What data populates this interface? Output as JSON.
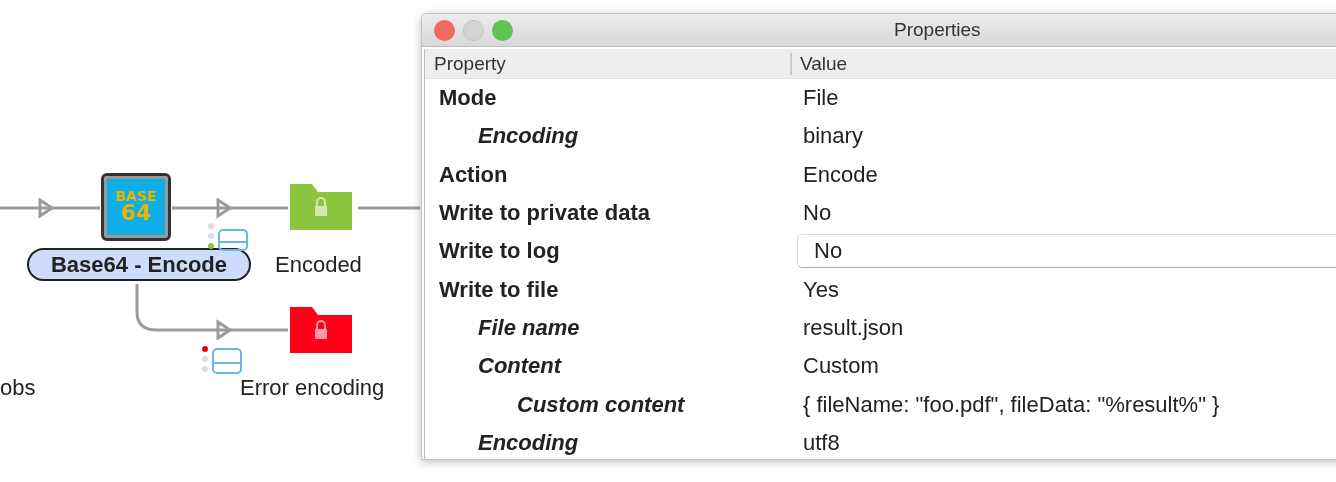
{
  "canvas": {
    "node": {
      "label": "Base64 - Encode",
      "icon_text": [
        "BASE",
        "64"
      ]
    },
    "folders": [
      {
        "label": "Encoded",
        "color": "#8cc63f"
      },
      {
        "label": "Error encoding",
        "color": "#ff0019"
      }
    ],
    "cut_label": "obs"
  },
  "window": {
    "title": "Properties"
  },
  "table": {
    "columns": [
      "Property",
      "Value"
    ],
    "rows": [
      {
        "name": "Mode",
        "value": "File",
        "editing": false,
        "children": [
          {
            "name": "Encoding",
            "value": "binary",
            "editing": false
          }
        ]
      },
      {
        "name": "Action",
        "value": "Encode",
        "editing": false
      },
      {
        "name": "Write to private data",
        "value": "No",
        "editing": false
      },
      {
        "name": "Write to log",
        "value": "No",
        "editing": true
      },
      {
        "name": "Write to file",
        "value": "Yes",
        "editing": false,
        "children": [
          {
            "name": "File name",
            "value": "result.json",
            "editing": false
          },
          {
            "name": "Content",
            "value": "Custom",
            "editing": false,
            "children": [
              {
                "name": "Custom content",
                "value": "{ fileName: \"foo.pdf\", fileData: \"%result%\" }",
                "editing": false
              }
            ]
          },
          {
            "name": "Encoding",
            "value": "utf8",
            "editing": false
          }
        ]
      }
    ]
  }
}
